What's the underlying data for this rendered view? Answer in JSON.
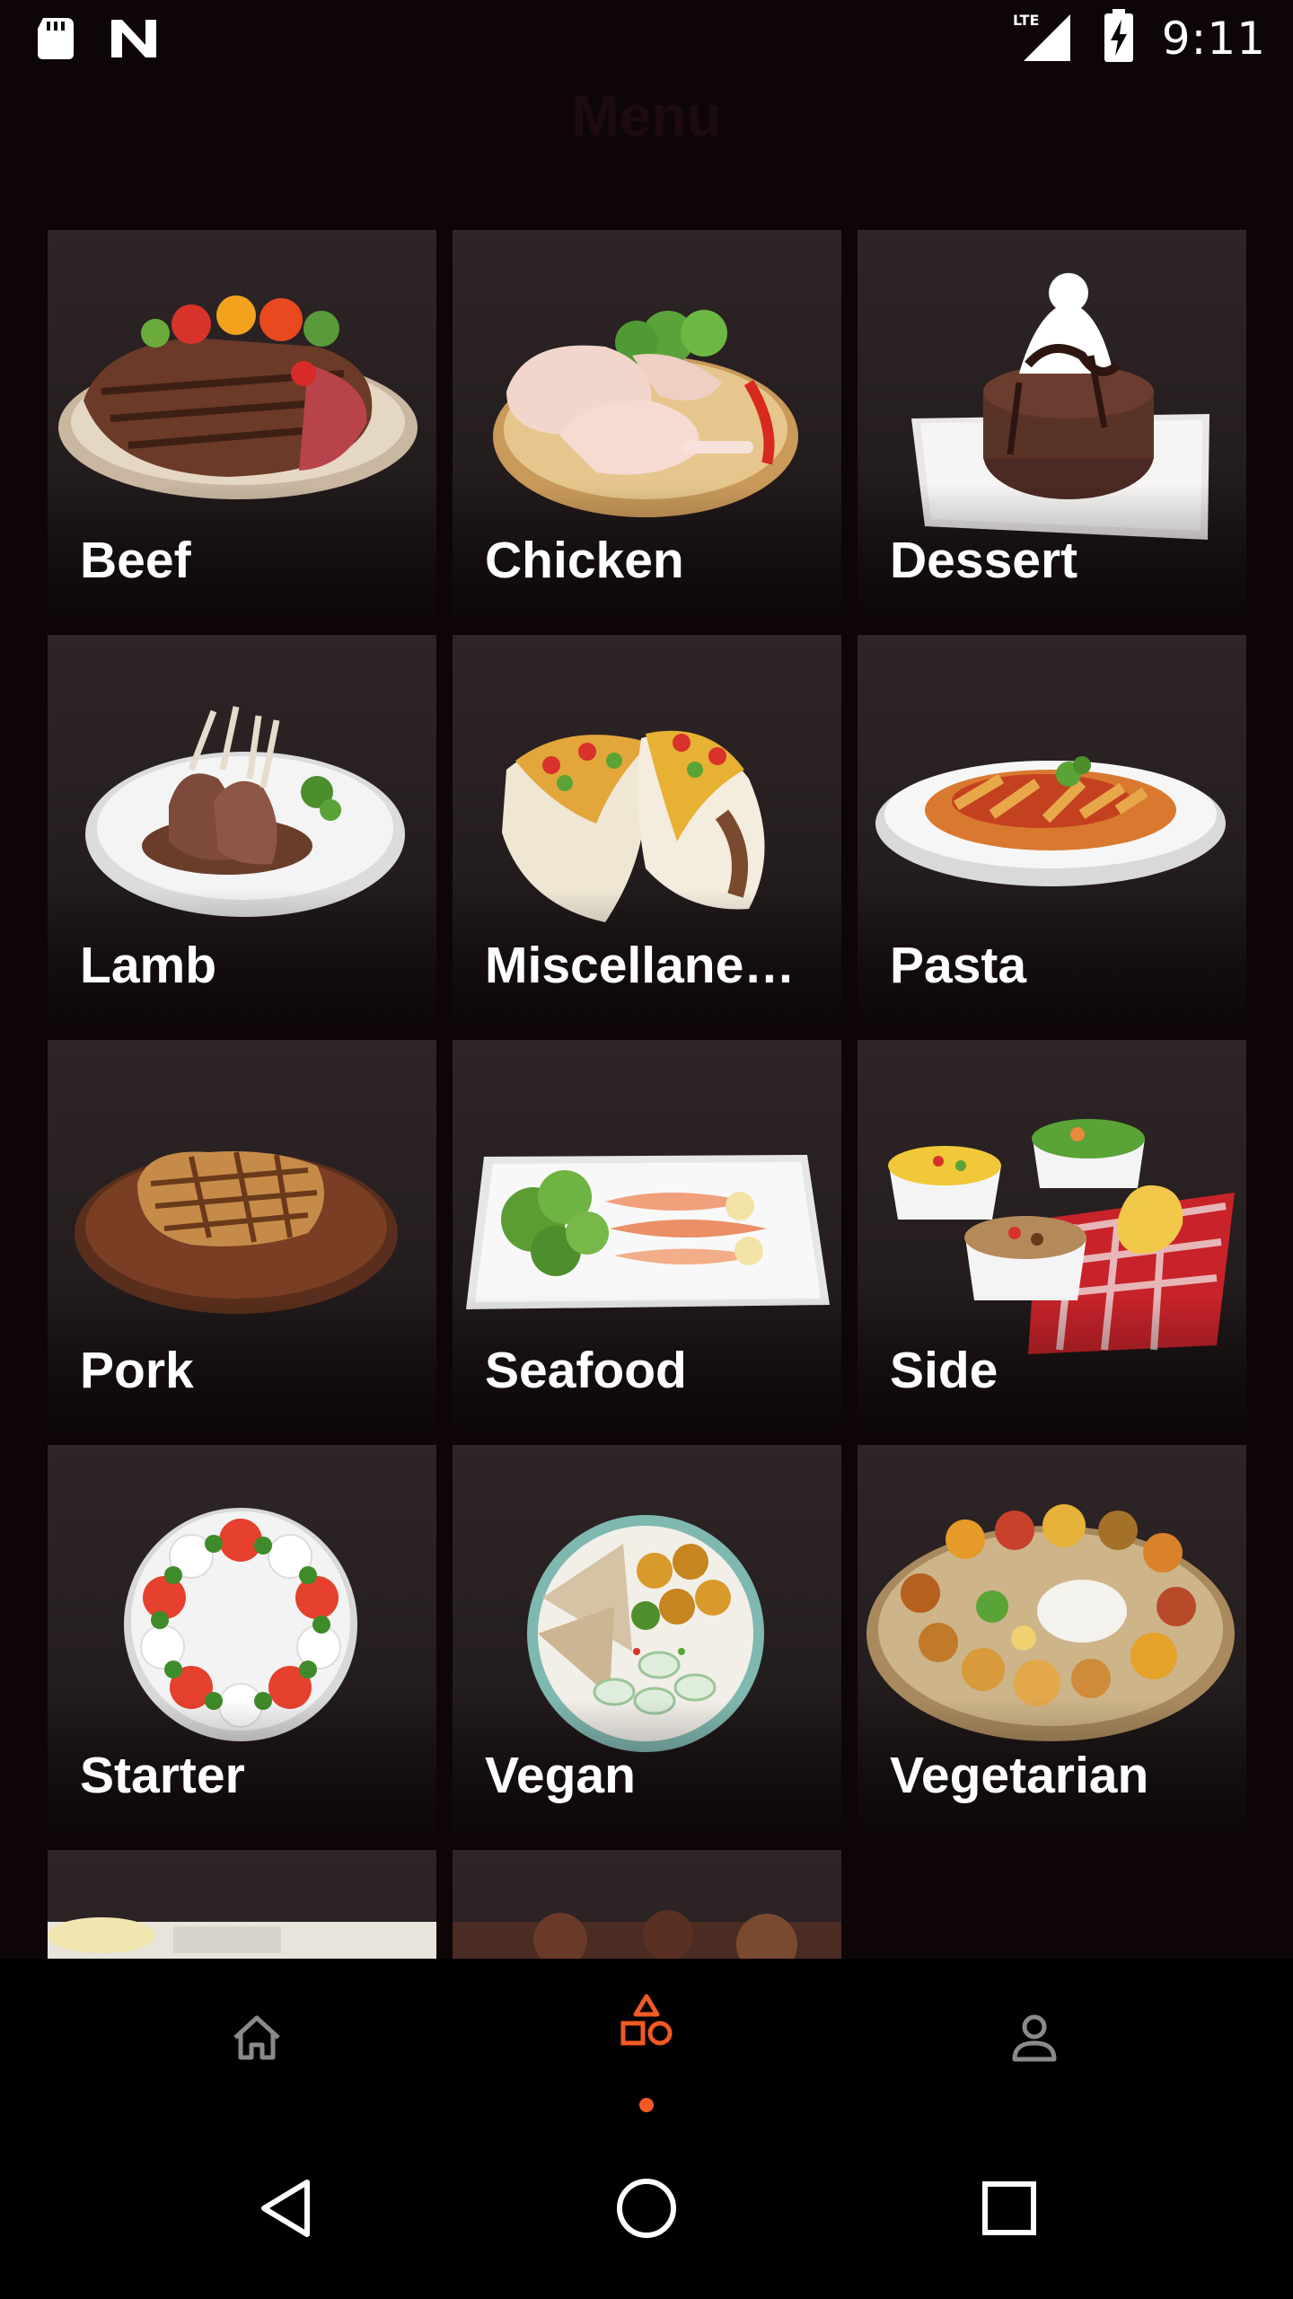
{
  "status_bar": {
    "time": "9:11",
    "network": "LTE",
    "icons": [
      "sd-card-icon",
      "n-logo-icon",
      "lte-signal-icon",
      "battery-charging-icon"
    ]
  },
  "header": {
    "title": "Menu"
  },
  "categories": [
    {
      "label": "Beef",
      "icon": "beef-steak-image"
    },
    {
      "label": "Chicken",
      "icon": "chicken-image"
    },
    {
      "label": "Dessert",
      "icon": "dessert-image"
    },
    {
      "label": "Lamb",
      "icon": "lamb-chops-image"
    },
    {
      "label": "Miscellaneous",
      "icon": "tacos-image"
    },
    {
      "label": "Pasta",
      "icon": "pasta-image"
    },
    {
      "label": "Pork",
      "icon": "pork-chop-image"
    },
    {
      "label": "Seafood",
      "icon": "salmon-plate-image"
    },
    {
      "label": "Side",
      "icon": "side-bowls-image"
    },
    {
      "label": "Starter",
      "icon": "caprese-image"
    },
    {
      "label": "Vegan",
      "icon": "vegan-plate-image"
    },
    {
      "label": "Vegetarian",
      "icon": "thali-image"
    }
  ],
  "bottom_nav": {
    "items": [
      {
        "name": "home",
        "icon": "home-icon",
        "active": false
      },
      {
        "name": "categories",
        "icon": "shapes-icon",
        "active": true
      },
      {
        "name": "profile",
        "icon": "person-icon",
        "active": false
      }
    ],
    "accent": "#f15a24",
    "inactive_color": "#8a8a8a"
  },
  "system_nav": {
    "icons": [
      "back-icon",
      "home-circle-icon",
      "recents-icon"
    ]
  }
}
